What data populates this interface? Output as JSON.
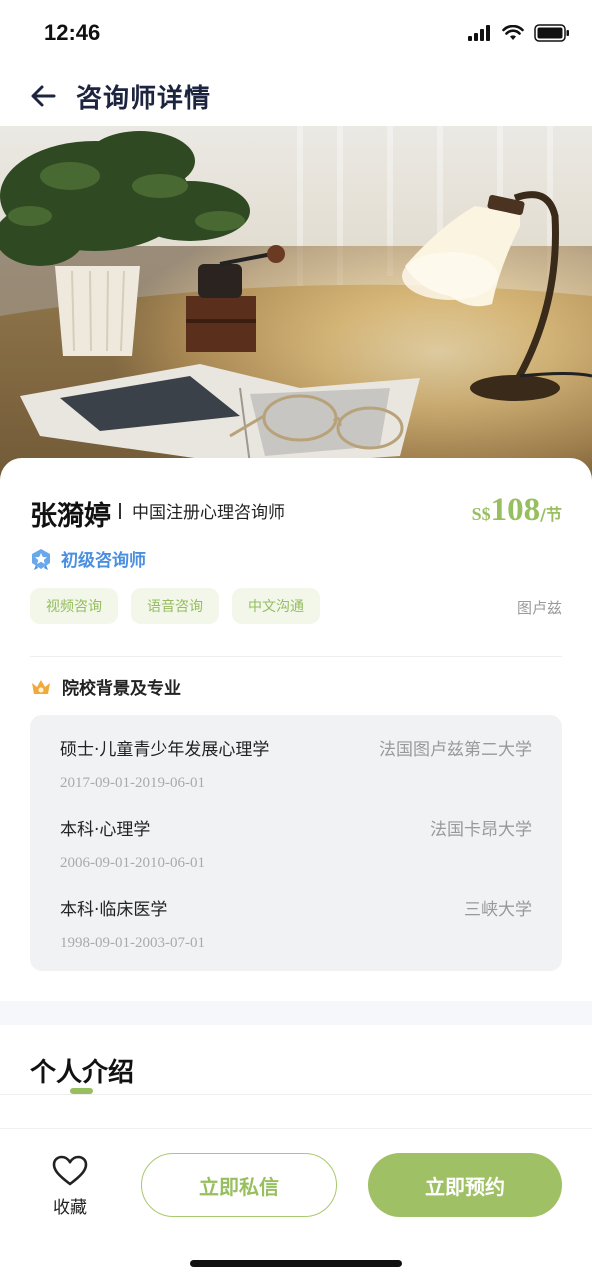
{
  "status_bar": {
    "time": "12:46"
  },
  "nav": {
    "title": "咨询师详情"
  },
  "counselor": {
    "name": "张漪婷",
    "title": "中国注册心理咨询师",
    "price_currency": "S$",
    "price_value": "108",
    "price_unit": "/节",
    "level": "初级咨询师",
    "location": "图卢兹",
    "tags": [
      "视频咨询",
      "语音咨询",
      "中文沟通"
    ]
  },
  "education": {
    "section_title": "院校背景及专业",
    "items": [
      {
        "degree": "硕士·儿童青少年发展心理学",
        "school": "法国图卢兹第二大学",
        "date": "2017-09-01-2019-06-01"
      },
      {
        "degree": "本科·心理学",
        "school": "法国卡昂大学",
        "date": "2006-09-01-2010-06-01"
      },
      {
        "degree": "本科·临床医学",
        "school": "三峡大学",
        "date": "1998-09-01-2003-07-01"
      }
    ]
  },
  "intro": {
    "title": "个人介绍"
  },
  "bottom_bar": {
    "favorite_label": "收藏",
    "message_button": "立即私信",
    "book_button": "立即预约"
  },
  "colors": {
    "accent_green": "#98bf5f",
    "level_blue": "#4a8fe0",
    "title_navy": "#1d2440"
  },
  "icons": [
    "back-arrow-icon",
    "signal-icon",
    "wifi-icon",
    "battery-icon",
    "badge-icon",
    "crown-icon",
    "heart-icon"
  ]
}
